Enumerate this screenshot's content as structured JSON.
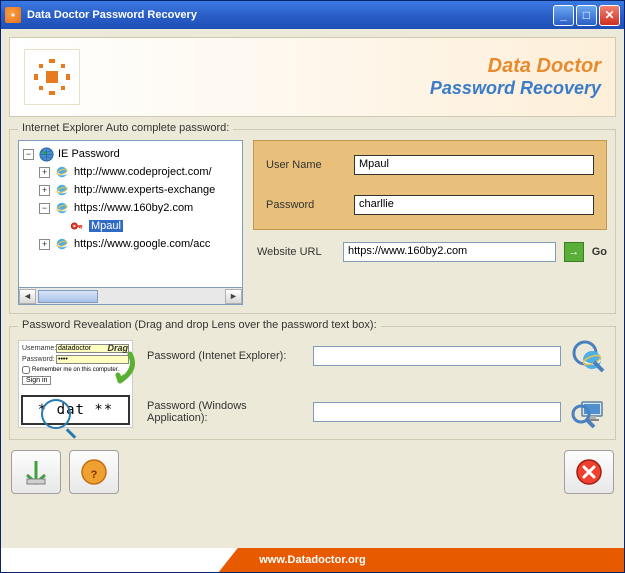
{
  "window": {
    "title": "Data Doctor Password Recovery"
  },
  "header": {
    "line1": "Data Doctor",
    "line2": "Password Recovery"
  },
  "autocomplete_group": {
    "label": "Internet Explorer Auto complete password:",
    "tree": {
      "root": "IE Password",
      "items": [
        {
          "expand": "+",
          "url": "http://www.codeproject.com/"
        },
        {
          "expand": "+",
          "url": "http://www.experts-exchange"
        },
        {
          "expand": "−",
          "url": "https://www.160by2.com"
        },
        {
          "expand": "+",
          "url": "https://www.google.com/acc"
        }
      ],
      "selected_child": "Mpaul"
    },
    "credentials": {
      "username_label": "User Name",
      "username_value": "Mpaul",
      "password_label": "Password",
      "password_value": "charllie"
    },
    "url": {
      "label": "Website URL",
      "value": "https://www.160by2.com",
      "go_label": "Go"
    }
  },
  "reveal_group": {
    "label": "Password Revealation (Drag and drop Lens over the password text box):",
    "demo": {
      "username_label": "Username:",
      "username_val": "datadoctor",
      "password_label": "Password:",
      "remember": "Remember me on this computer.",
      "signin": "Sign in",
      "drag": "Drag",
      "zoom_text": "* dat **"
    },
    "ie_label": "Password (Intenet Explorer):",
    "win_label": "Password (Windows Application):"
  },
  "footer": {
    "text": "www.Datadoctor.org"
  }
}
